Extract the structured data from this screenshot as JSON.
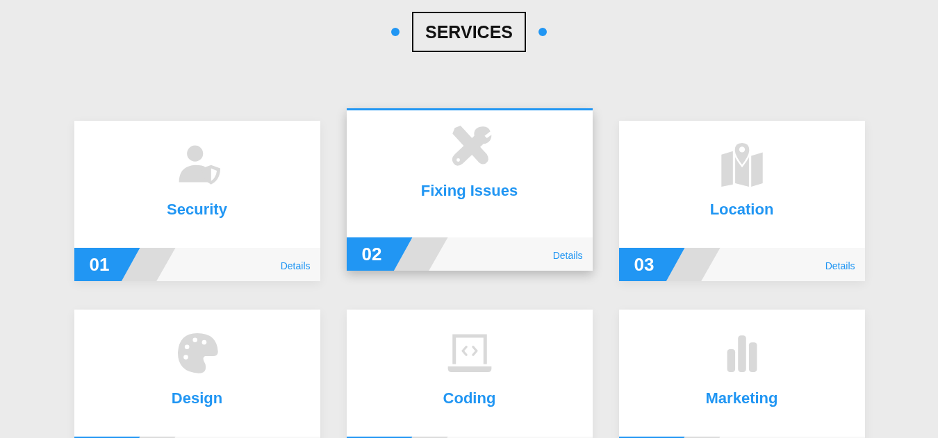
{
  "heading": "SERVICES",
  "cards": [
    {
      "kind": "security",
      "title": "Security",
      "number": "01",
      "link": "Details",
      "selected": false
    },
    {
      "kind": "repair",
      "title": "Fixing Issues",
      "number": "02",
      "link": "Details",
      "selected": true
    },
    {
      "kind": "location",
      "title": "Location",
      "number": "03",
      "link": "Details",
      "selected": false
    },
    {
      "kind": "design",
      "title": "Design",
      "selected": false
    },
    {
      "kind": "coding",
      "title": "Coding",
      "selected": false
    },
    {
      "kind": "marketing",
      "title": "Marketing",
      "selected": false
    }
  ]
}
